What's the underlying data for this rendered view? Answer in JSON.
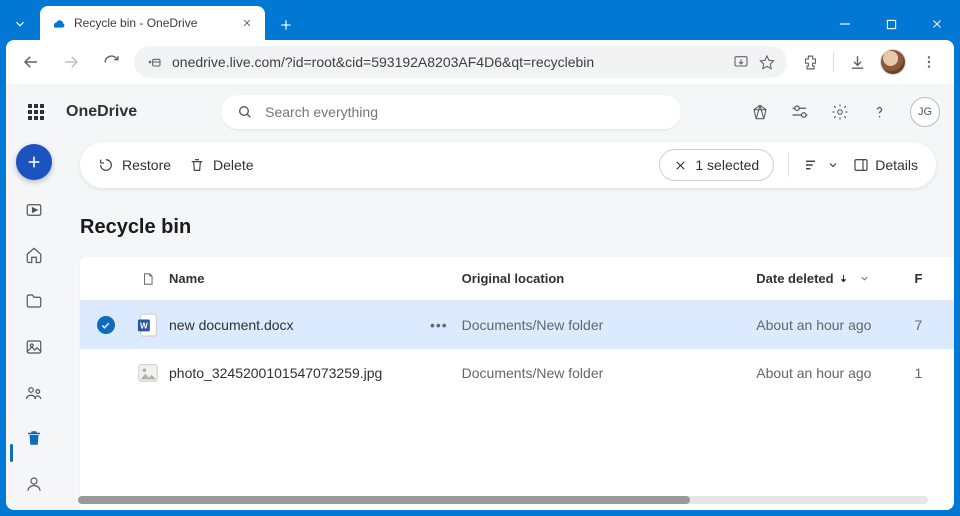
{
  "browser": {
    "tab_title": "Recycle bin - OneDrive",
    "url": "onedrive.live.com/?id=root&cid=593192A8203AF4D6&qt=recyclebin"
  },
  "header": {
    "brand": "OneDrive",
    "search_placeholder": "Search everything",
    "user_initials": "JG"
  },
  "commandbar": {
    "restore": "Restore",
    "delete": "Delete",
    "selected_count": "1 selected",
    "details": "Details"
  },
  "page": {
    "title": "Recycle bin"
  },
  "table": {
    "columns": {
      "name": "Name",
      "location": "Original location",
      "date": "Date deleted",
      "size": "F"
    },
    "rows": [
      {
        "selected": true,
        "type": "docx",
        "name": "new document.docx",
        "location": "Documents/New folder",
        "date": "About an hour ago",
        "size": "7"
      },
      {
        "selected": false,
        "type": "image",
        "name": "photo_3245200101547073259.jpg",
        "location": "Documents/New folder",
        "date": "About an hour ago",
        "size": "1"
      }
    ]
  }
}
